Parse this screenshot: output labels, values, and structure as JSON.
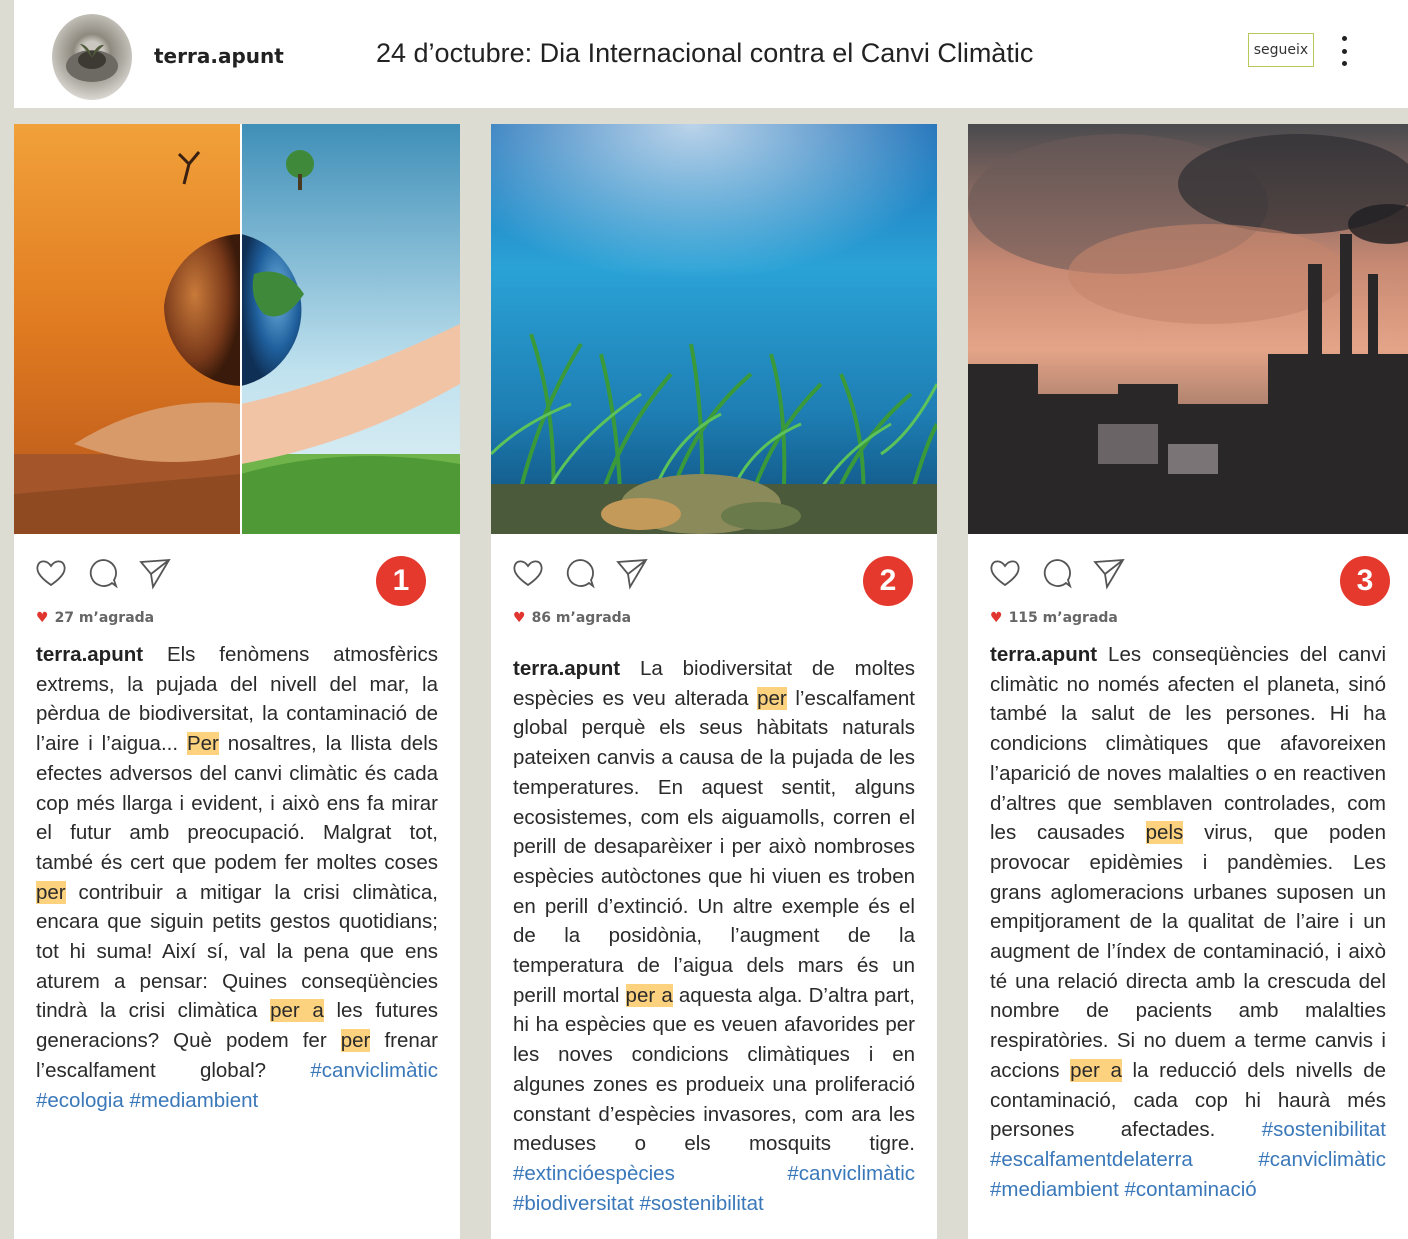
{
  "header": {
    "username": "terra.apunt",
    "title": "24 d’octubre: Dia Internacional contra el Canvi Climàtic",
    "follow_label": "segueix",
    "avatar_icon": "hands-holding-seedling",
    "more_icon": "vertical-ellipsis-icon"
  },
  "colors": {
    "number_badge": "#e5392e",
    "highlight": "#fdd27f",
    "hashtag": "#3a78b9",
    "heart": "#e0362f"
  },
  "posts": [
    {
      "number": "1",
      "likes": "27 m’agrada",
      "user": "terra.apunt",
      "text_1": " Els fenòmens atmosfèrics extrems, la pujada del nivell del mar, la pèrdua de biodiversitat, la contaminació de l’aire i l’aigua... ",
      "hl_1": "Per",
      "text_2": " nosaltres, la llista dels efectes adversos del canvi climàtic és cada cop més llarga i evident, i això ens fa mirar el futur amb preocupació. Malgrat tot, també és cert que podem fer moltes coses ",
      "hl_2": "per",
      "text_3": " contribuir a mitigar la crisi climàtica, encara que siguin petits gestos quotidians; tot hi suma! Així sí, val la pena que ens aturem a pensar: Quines conseqüències tindrà la crisi climàtica ",
      "hl_3": "per a",
      "text_4": " les futures generacions? Què podem fer ",
      "hl_4": "per",
      "text_5": " frenar l’escalfament global? ",
      "tags": "#canviclimàtic #ecologia #mediambient"
    },
    {
      "number": "2",
      "likes": "86 m’agrada",
      "user": "terra.apunt",
      "text_1": " La biodiversitat de moltes espècies es veu alterada ",
      "hl_1": "per",
      "text_2": " l’escalfament global perquè els seus hàbitats naturals pateixen canvis a causa de la pujada de les temperatures. En aquest sentit, alguns ecosistemes, com els aiguamolls, corren el perill de desaparèixer i per això nombroses espècies autòctones que hi viuen es troben en perill d’extinció. Un altre exemple és el de la posidònia, l’augment de la temperatura de l’aigua dels mars és un perill mortal ",
      "hl_2": "per a",
      "text_3": " aquesta alga. D’altra part, hi ha espècies que es veuen afavorides per les noves condicions climàtiques i en algunes zones es produeix una proliferació constant d’espècies invasores, com ara les meduses o els mosquits tigre. ",
      "tags": "#extincióespècies #canviclimàtic #biodiversitat #sostenibilitat"
    },
    {
      "number": "3",
      "likes": "115 m’agrada",
      "user": "terra.apunt",
      "text_1": " Les conseqüències del canvi climàtic no només afecten el planeta, sinó també la salut de les persones. Hi ha condicions climàtiques que afavoreixen l’aparició de noves malalties o en reactiven d’altres que semblaven controlades, com les causades ",
      "hl_1": "pels",
      "text_2": " virus, que poden provocar epidèmies i pandèmies. Les grans aglomeracions urbanes suposen un empitjorament de la qualitat de l’aire i un augment de l’índex de contaminació, i això té una relació directa amb la crescuda del nombre de pacients amb malalties respiratòries. Si no duem a terme canvis i accions ",
      "hl_2": "per a",
      "text_3": " la reducció dels nivells de contaminació, cada cop hi haurà més persones afectades. ",
      "tags": "#sostenibilitat #escalfamentdelaterra #canviclimàtic #mediambient #contaminació"
    }
  ]
}
